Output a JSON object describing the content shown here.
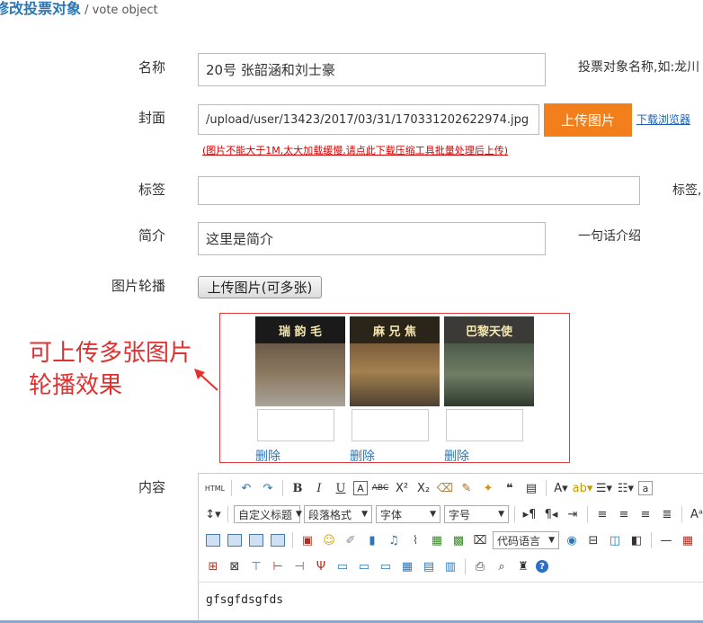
{
  "header": {
    "title": "修改投票对象",
    "separator": " / ",
    "subtitle": "vote object"
  },
  "form": {
    "name_label": "名称",
    "name_value": "20号 张韶涵和刘士豪",
    "name_hint": "投票对象名称,如:龙川",
    "cover_label": "封面",
    "cover_value": "/upload/user/13423/2017/03/31/170331202622974.jpg",
    "upload_button": "上传图片",
    "browser_link": "下载浏览器",
    "cover_note": "(图片不能大于1M,太大加载缓慢,请点此下载压缩工具批量处理后上传)",
    "tag_label": "标签",
    "tag_value": "",
    "tag_hint": "标签,",
    "intro_label": "简介",
    "intro_value": "这里是简介",
    "intro_hint": "一句话介绍",
    "carousel_label": "图片轮播",
    "carousel_button": "上传图片(可多张)",
    "content_label": "内容",
    "content_value": "gfsgfdsgfds"
  },
  "gallery": {
    "items": [
      {
        "sign_text": "瑞 韵 毛",
        "delete": "删除",
        "sign_color": "#1a1a1a",
        "body_color": "#7a6a55"
      },
      {
        "sign_text": "麻 兄 焦",
        "delete": "删除",
        "sign_color": "#2b2418",
        "body_color": "#8a6b45"
      },
      {
        "sign_text": "巴黎天使",
        "delete": "删除",
        "sign_color": "#3c3a36",
        "body_color": "#5d6a58"
      }
    ]
  },
  "annotation": {
    "line1": "可上传多张图片",
    "line2": "轮播效果"
  },
  "editor": {
    "toolbar": {
      "html": "HTML",
      "custom_heading": "自定义标题",
      "paragraph": "段落格式",
      "font": "字体",
      "size": "字号",
      "code_lang": "代码语言"
    }
  }
}
